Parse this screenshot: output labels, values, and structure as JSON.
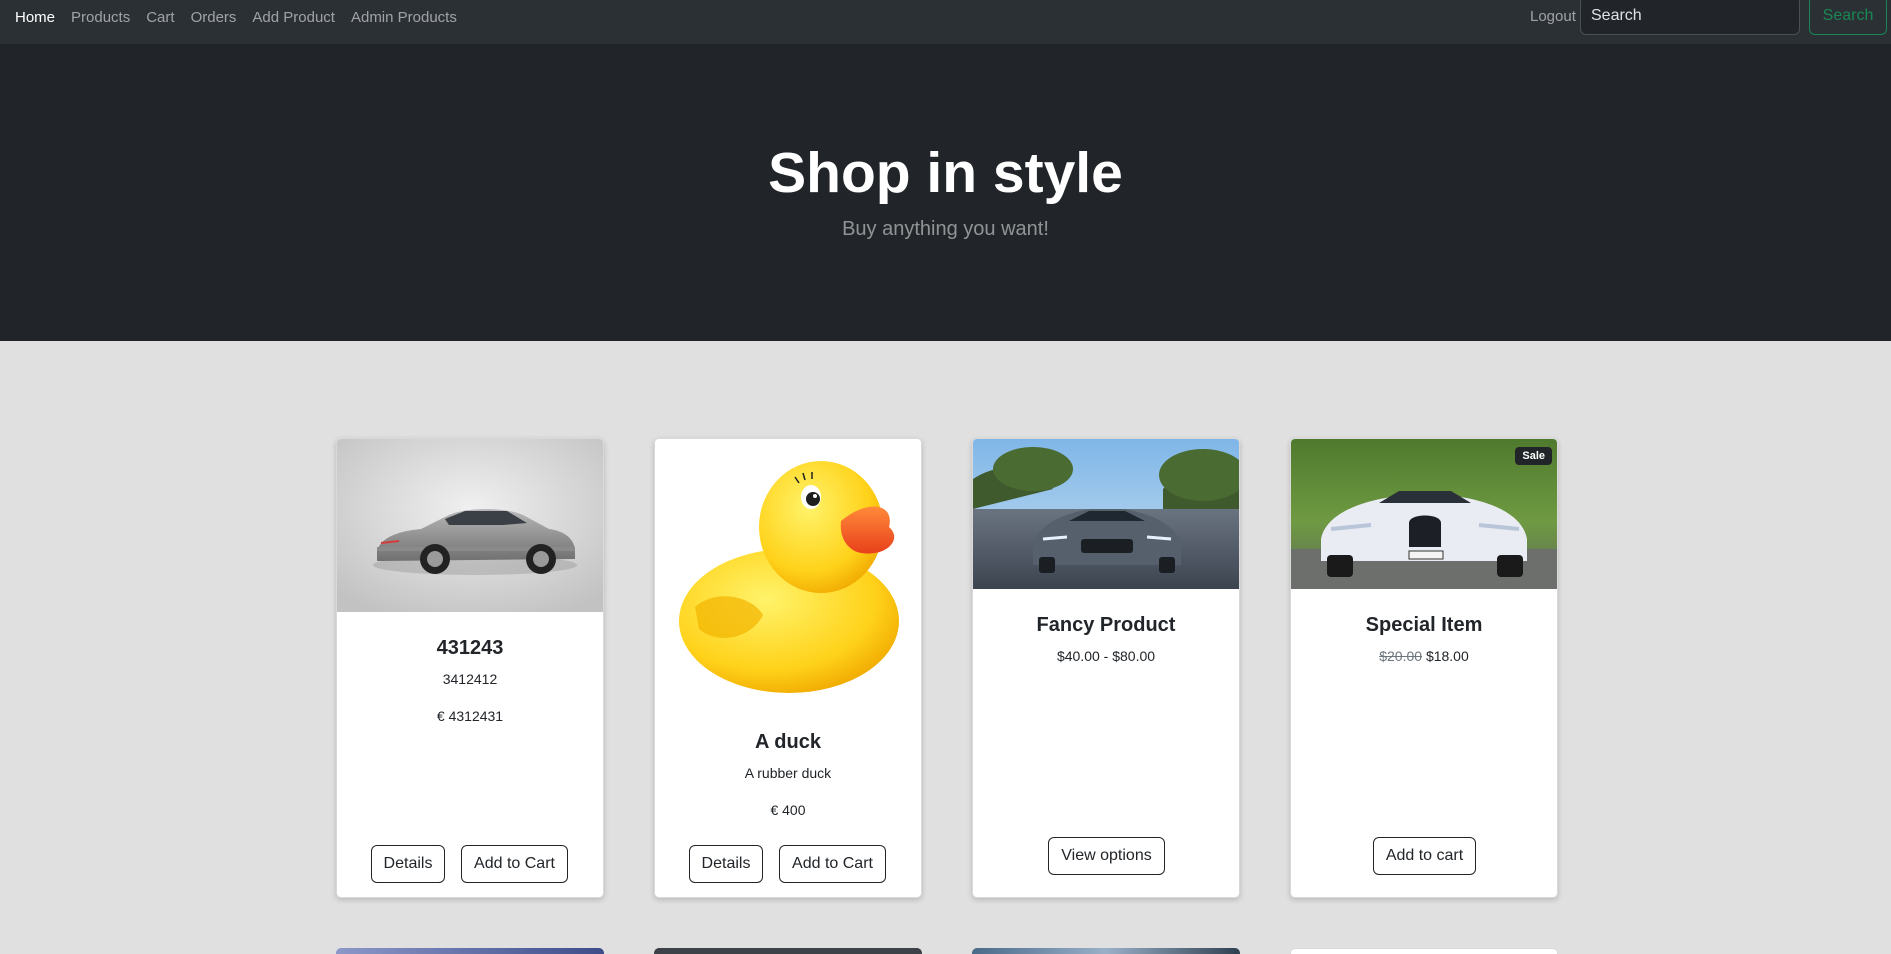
{
  "navbar": {
    "links": [
      {
        "label": "Home",
        "active": true
      },
      {
        "label": "Products",
        "active": false
      },
      {
        "label": "Cart",
        "active": false
      },
      {
        "label": "Orders",
        "active": false
      },
      {
        "label": "Add Product",
        "active": false
      },
      {
        "label": "Admin Products",
        "active": false
      }
    ],
    "logout_label": "Logout",
    "search": {
      "placeholder": "Search",
      "value": "",
      "button_label": "Search"
    }
  },
  "hero": {
    "title": "Shop in style",
    "subtitle": "Buy anything you want!"
  },
  "products": [
    {
      "title": "431243",
      "description": "3412412",
      "price": "€ 4312431",
      "image": "silver-sedan-car",
      "buttons": [
        "Details",
        "Add to Cart"
      ]
    },
    {
      "title": "A duck",
      "description": "A rubber duck",
      "price": "€ 400",
      "image": "yellow-rubber-duck",
      "buttons": [
        "Details",
        "Add to Cart"
      ]
    },
    {
      "title": "Fancy Product",
      "price_range": "$40.00 - $80.00",
      "image": "grey-sedan-car-road",
      "button": "View options"
    },
    {
      "title": "Special Item",
      "old_price": "$20.00",
      "price": "$18.00",
      "badge": "Sale",
      "image": "white-hypercar",
      "button": "Add to cart"
    }
  ],
  "colors": {
    "navbar_bg": "#2b3035",
    "hero_bg": "#212529",
    "page_bg": "#e0e0e0",
    "search_accent": "#198754"
  }
}
